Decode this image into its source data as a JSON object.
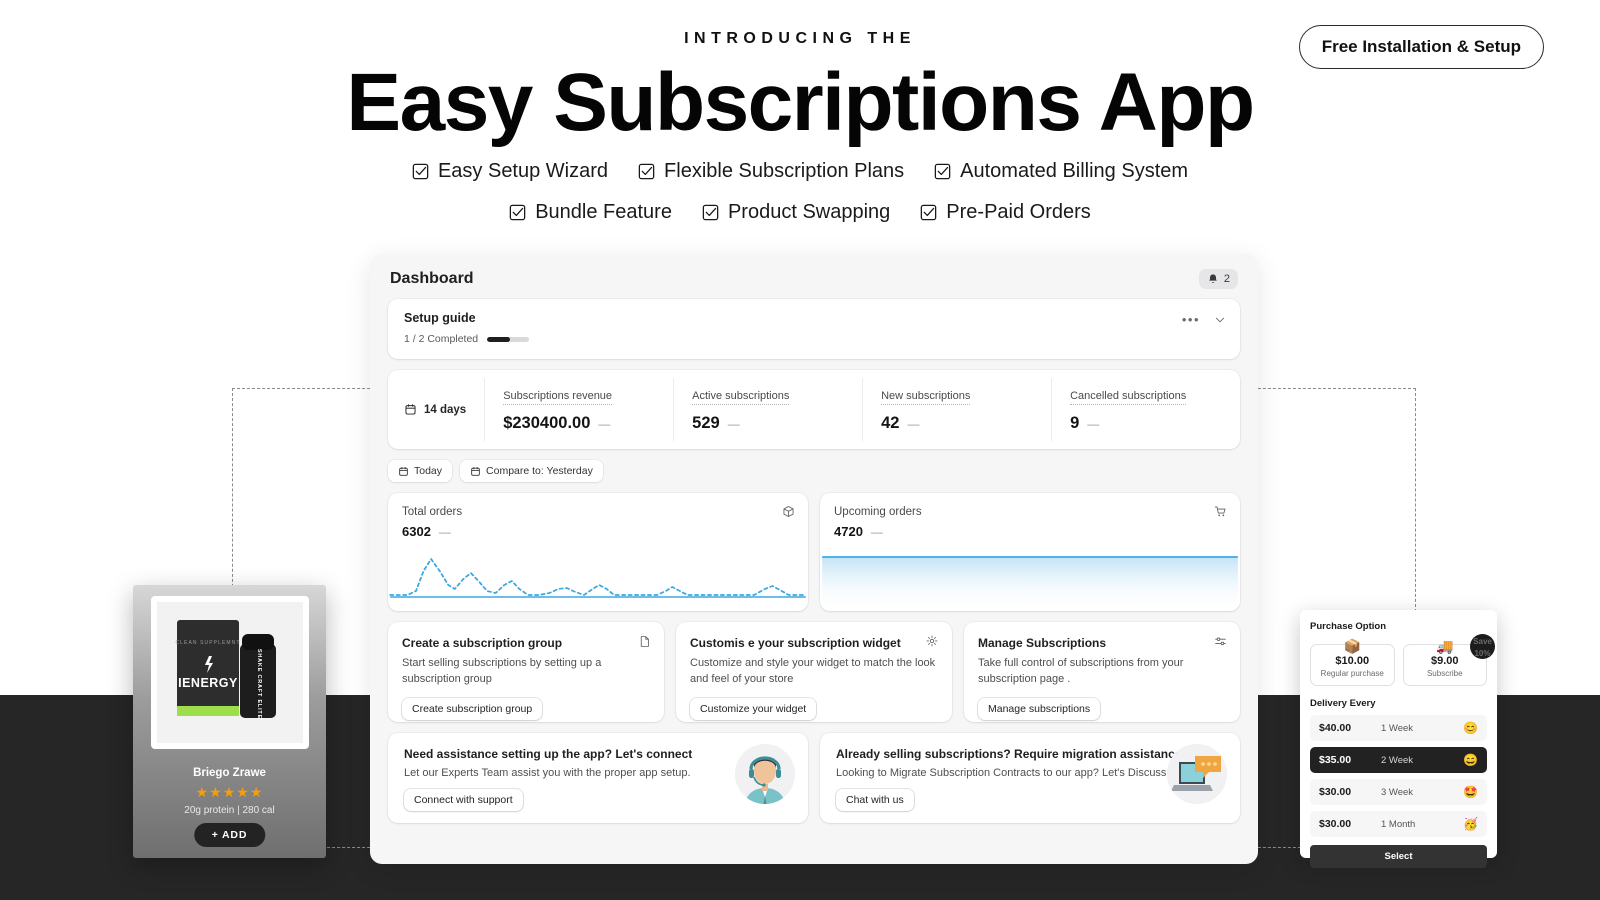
{
  "header": {
    "eyebrow": "INTRODUCING THE",
    "headline": "Easy Subscriptions App",
    "badge": "Free Installation & Setup",
    "features_row1": [
      "Easy Setup Wizard",
      "Flexible Subscription Plans",
      "Automated Billing System"
    ],
    "features_row2": [
      "Bundle Feature",
      "Product Swapping",
      "Pre-Paid Orders"
    ]
  },
  "dashboard": {
    "title": "Dashboard",
    "notification_count": "2",
    "setup_guide": {
      "title": "Setup guide",
      "progress_label": "1 / 2 Completed",
      "menu_dots": "•••",
      "chevron": "⌄"
    },
    "stats": {
      "range_label": "14 days",
      "items": [
        {
          "label": "Subscriptions revenue",
          "value": "$230400.00",
          "delta": "—"
        },
        {
          "label": "Active subscriptions",
          "value": "529",
          "delta": "—"
        },
        {
          "label": "New subscriptions",
          "value": "42",
          "delta": "—"
        },
        {
          "label": "Cancelled subscriptions",
          "value": "9",
          "delta": "—"
        }
      ]
    },
    "chips": [
      "Today",
      "Compare to: Yesterday"
    ],
    "order_cards": [
      {
        "label": "Total orders",
        "value": "6302",
        "delta": "—",
        "icon": "package-icon"
      },
      {
        "label": "Upcoming orders",
        "value": "4720",
        "delta": "—",
        "icon": "cart-icon"
      }
    ],
    "action_cards": [
      {
        "title": "Create a subscription group",
        "desc": "Start selling subscriptions by setting up a subscription group",
        "button": "Create subscription group",
        "icon": "document-icon"
      },
      {
        "title": "Customis e your subscription widget",
        "desc": "Customize and style your widget to match the look and feel of your store",
        "button": "Customize your widget",
        "icon": "gear-icon"
      },
      {
        "title": "Manage Subscriptions",
        "desc": "Take full control of subscriptions from your subscription page .",
        "button": "Manage subscriptions",
        "icon": "sliders-icon"
      }
    ],
    "support_cards": [
      {
        "title": "Need assistance setting up the app? Let's connect",
        "desc": "Let our Experts Team assist you with the proper app setup.",
        "button": "Connect with support",
        "art": "support-agent-avatar"
      },
      {
        "title": "Already selling subscriptions? Require migration assistance?",
        "desc": "Looking to Migrate Subscription Contracts to our app? Let's Discuss.",
        "button": "Chat with us",
        "art": "laptop-chat-illustration"
      }
    ]
  },
  "product_card": {
    "brand_tagline": "CLEAN SUPPLEMNT",
    "brand": "IENERGY",
    "shaker_label": "SHAKE CRAFT ELITE",
    "name": "Briego Zrawe",
    "stars": "★★★★★",
    "meta": "20g protein | 280 cal",
    "add_button": "+ ADD"
  },
  "purchase_panel": {
    "title": "Purchase Option",
    "options": [
      {
        "emoji": "📦",
        "price": "$10.00",
        "label": "Regular purchase"
      },
      {
        "emoji": "🚚",
        "price": "$9.00",
        "label": "Subscribe",
        "badge_line1": "Save",
        "badge_line2": "10%"
      }
    ],
    "delivery_title": "Delivery Every",
    "delivery_rows": [
      {
        "price": "$40.00",
        "period": "1 Week",
        "emoji": "😊",
        "active": false
      },
      {
        "price": "$35.00",
        "period": "2 Week",
        "emoji": "😄",
        "active": true
      },
      {
        "price": "$30.00",
        "period": "3 Week",
        "emoji": "🤩",
        "active": false
      },
      {
        "price": "$30.00",
        "period": "1 Month",
        "emoji": "🥳",
        "active": false
      }
    ],
    "select_button": "Select"
  },
  "colors": {
    "accent_blue": "#3ba8e0",
    "dark": "#262626",
    "star": "#f59e0b",
    "panel_bg": "#f6f6f7"
  }
}
